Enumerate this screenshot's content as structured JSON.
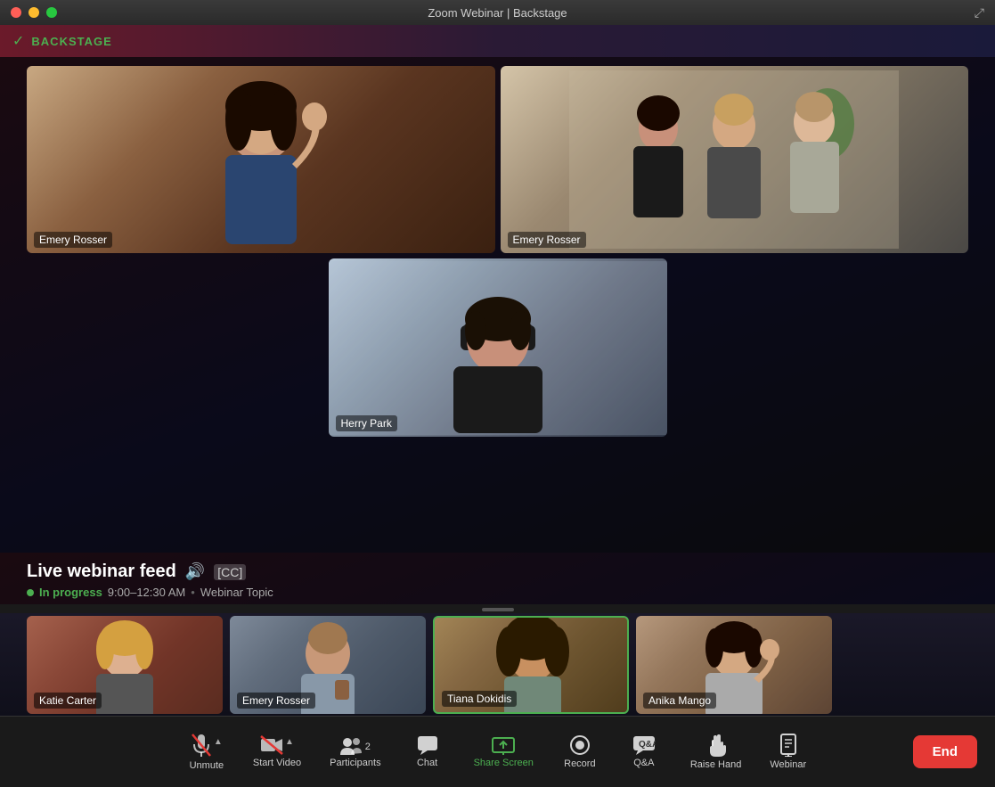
{
  "window": {
    "title": "Zoom Webinar | Backstage"
  },
  "titlebar": {
    "buttons": {
      "close": "close",
      "minimize": "minimize",
      "maximize": "maximize"
    },
    "expand_icon": "⤢"
  },
  "backstage": {
    "label": "BACKSTAGE",
    "icon": "✓"
  },
  "video_tiles": [
    {
      "name": "Emery Rosser",
      "position": "top-left"
    },
    {
      "name": "Emery Rosser",
      "position": "top-right"
    },
    {
      "name": "Herry Park",
      "position": "bottom-center"
    }
  ],
  "live_feed": {
    "title": "Live webinar feed",
    "status": "In progress",
    "time": "9:00–12:30 AM",
    "separator": "•",
    "topic": "Webinar Topic"
  },
  "participants": [
    {
      "name": "Katie Carter",
      "active": false
    },
    {
      "name": "Emery Rosser",
      "active": false
    },
    {
      "name": "Tiana Dokidis",
      "active": true
    },
    {
      "name": "Anika Mango",
      "active": false
    }
  ],
  "toolbar": {
    "unmute_label": "Unmute",
    "start_video_label": "Start Video",
    "participants_label": "Participants",
    "participants_count": "2",
    "chat_label": "Chat",
    "share_screen_label": "Share Screen",
    "record_label": "Record",
    "qa_label": "Q&A",
    "raise_hand_label": "Raise Hand",
    "webinar_label": "Webinar",
    "end_label": "End"
  }
}
